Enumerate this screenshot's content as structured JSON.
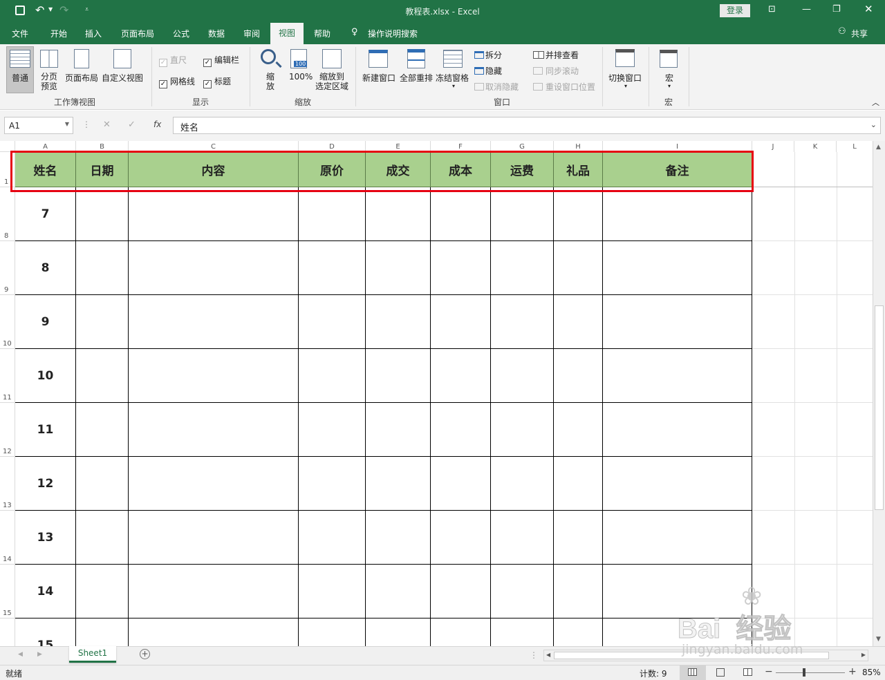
{
  "titlebar": {
    "title": "教程表.xlsx  -  Excel",
    "login": "登录"
  },
  "menu": {
    "items": [
      "文件",
      "开始",
      "插入",
      "页面布局",
      "公式",
      "数据",
      "审阅",
      "视图",
      "帮助"
    ],
    "active": "视图",
    "search": "操作说明搜索",
    "share": "共享"
  },
  "ribbon": {
    "workbook_views": {
      "normal": "普通",
      "page_break": "分页\n预览",
      "page_layout": "页面布局",
      "custom": "自定义视图",
      "group": "工作簿视图"
    },
    "show": {
      "ruler": "直尺",
      "formula_bar": "编辑栏",
      "gridlines": "网格线",
      "headings": "标题",
      "group": "显示"
    },
    "zoom": {
      "zoom": "缩\n放",
      "hundred": "100%",
      "to_selection": "缩放到\n选定区域",
      "group": "缩放"
    },
    "window": {
      "new": "新建窗口",
      "arrange": "全部重排",
      "freeze": "冻结窗格",
      "split": "拆分",
      "hide": "隐藏",
      "unhide": "取消隐藏",
      "side_by_side": "并排查看",
      "sync_scroll": "同步滚动",
      "reset_pos": "重设窗口位置",
      "switch": "切换窗口",
      "group": "窗口"
    },
    "macros": {
      "macro": "宏",
      "group": "宏"
    }
  },
  "formula_bar": {
    "name_box": "A1",
    "fx": "fx",
    "value": "姓名"
  },
  "columns": [
    "A",
    "B",
    "C",
    "D",
    "E",
    "F",
    "G",
    "H",
    "I",
    "J",
    "K",
    "L"
  ],
  "header_row": [
    "姓名",
    "日期",
    "内容",
    "原价",
    "成交",
    "成本",
    "运费",
    "礼品",
    "备注"
  ],
  "row_numbers": [
    "1",
    "8",
    "9",
    "10",
    "11",
    "12",
    "13",
    "14",
    "15"
  ],
  "data_rows": [
    "7",
    "8",
    "9",
    "10",
    "11",
    "12",
    "13",
    "14",
    "15"
  ],
  "sheet_tab": "Sheet1",
  "status": {
    "ready": "就绪",
    "count": "计数: 9",
    "zoom": "85%"
  },
  "watermark": {
    "brand": "Bai  经验",
    "url": "jingyan.baidu.com"
  }
}
